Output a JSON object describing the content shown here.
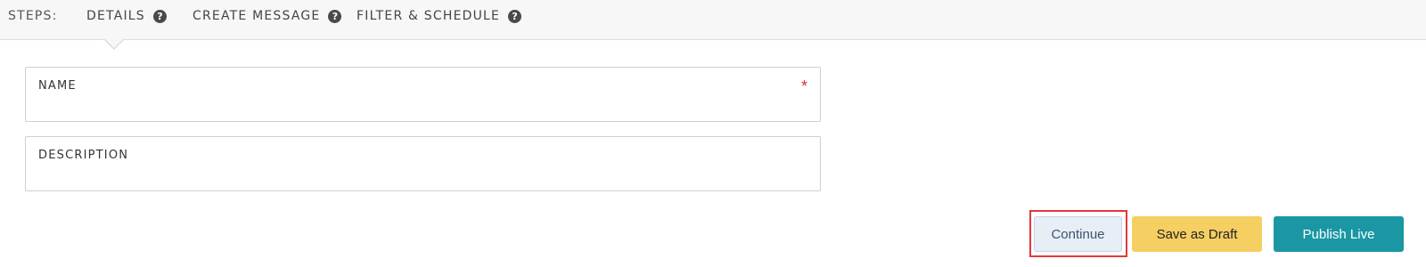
{
  "steps": {
    "label": "STEPS:",
    "items": [
      {
        "label": "DETAILS",
        "help_icon": "question-circle-icon"
      },
      {
        "label": "CREATE MESSAGE",
        "help_icon": "question-circle-icon"
      },
      {
        "label": "FILTER & SCHEDULE",
        "help_icon": "question-circle-icon"
      }
    ],
    "active_index": 0,
    "help_glyph": "?"
  },
  "form": {
    "name": {
      "label": "NAME",
      "required_mark": "*",
      "value": ""
    },
    "description": {
      "label": "DESCRIPTION",
      "value": ""
    }
  },
  "actions": {
    "continue_label": "Continue",
    "save_draft_label": "Save as Draft",
    "publish_label": "Publish Live"
  },
  "colors": {
    "required": "#d9342b",
    "draft_button": "#f5cf62",
    "publish_button": "#1a97a3",
    "continue_button": "#e8eef5",
    "highlight": "#e0393e"
  }
}
